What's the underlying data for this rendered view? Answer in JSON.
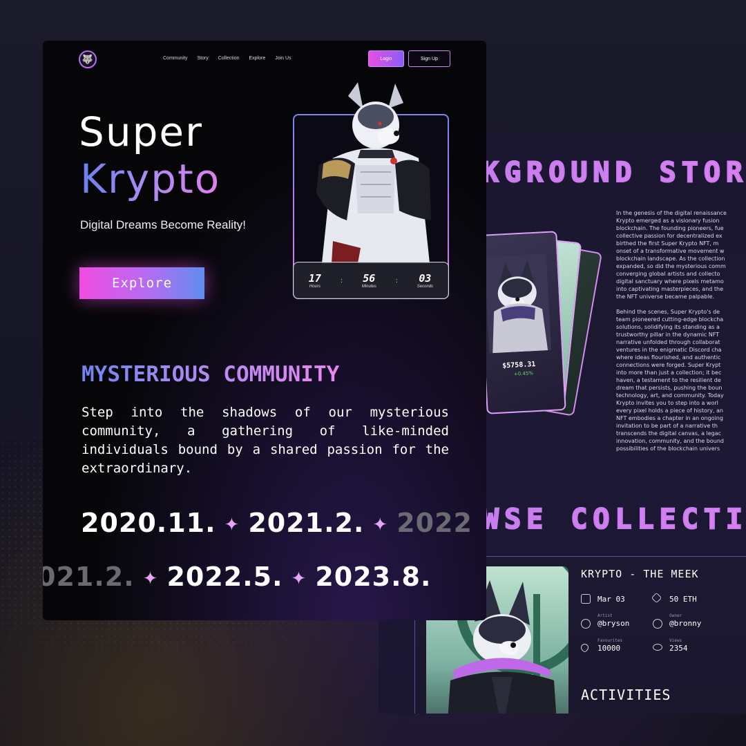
{
  "colors": {
    "accent_pink": "#e84fe4",
    "accent_purple": "#8b5cf6",
    "accent_blue": "#6a7ff0",
    "background": "#060608",
    "positive": "#5ee06b"
  },
  "nav": {
    "logo_icon": "wolf-logo-icon",
    "items": [
      "Community",
      "Story",
      "Collection",
      "Explore",
      "Join Us"
    ],
    "login": "Login",
    "signup": "Sign Up"
  },
  "hero": {
    "title_line1": "Super",
    "title_line2": "Krypto",
    "tagline": "Digital Dreams Become Reality!",
    "explore": "Explore",
    "timer": [
      {
        "value": "17",
        "label": "Hours"
      },
      {
        "value": "56",
        "label": "Minutes"
      },
      {
        "value": "03",
        "label": "Seconds"
      }
    ],
    "timer_separator": ":"
  },
  "community": {
    "title": "MYSTERIOUS COMMUNITY",
    "text": "Step into the shadows of our mysterious community, a gathering of like-minded individuals bound by a shared passion for the extraordinary."
  },
  "timeline": {
    "row1": [
      "2020.11.",
      "2021.2.",
      "2022"
    ],
    "row2": [
      "021.2.",
      "2022.5.",
      "2023.8."
    ],
    "separator": "✦"
  },
  "story": {
    "title": "KGROUND STOR",
    "text": "In the genesis of the digital renaissance\nKrypto emerged as a visionary fusion\nblockchain. The founding pioneers, fue\ncollective passion for decentralized ex\nbirthed the first Super Krypto NFT, m\nonset of a transformative movement w\nblockchain landscape. As the collection\nexpanded, so did the mysterious comm\nconverging global artists and collecto\ndigital sanctuary where pixels metamo\ninto captivating masterpieces, and the\nthe NFT universe became palpable.\n\nBehind the scenes, Super Krypto's de\nteam pioneered cutting-edge blockcha\nsolutions, solidifying its standing as a\ntrustworthy pillar in the dynamic NFT\nnarrative unfolded through collaborat\nventures in the enigmatic Discord cha\nwhere ideas flourished, and authentic\nconnections were forged. Super Krypt\ninto more than just a collection; it bec\nhaven, a testament to the resilient de\ndream that persists, pushing the boun\ntechnology, art, and community. Today\nKrypto invites you to step into a worl\nevery pixel holds a piece of history, an\nNFT embodies a chapter in an ongoing\ninvitation to be part of a narrative th\ntranscends the digital canvas, a legac\ninnovation, community, and the bound\npossibilities of the blockchain univers",
    "card_price": "$5758.31",
    "card_change": "+0.45%"
  },
  "collection": {
    "title": "WSE COLLECTIO",
    "name": "KRYPTO - THE MEEK",
    "date": "Mar 03",
    "price": "50 ETH",
    "artist_label": "Artist",
    "artist": "@bryson",
    "owner_label": "Owner",
    "owner": "@bronny",
    "favourites_label": "Favourites",
    "favourites": "10000",
    "views_label": "Views",
    "views": "2354",
    "activities": "ACTIVITIES"
  }
}
